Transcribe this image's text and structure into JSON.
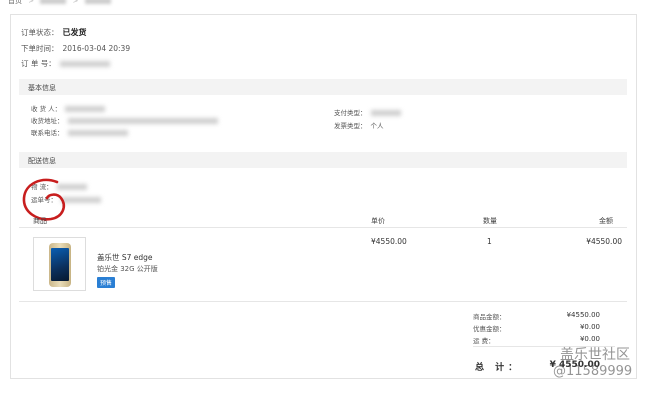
{
  "breadcrumb": {
    "home": "首页",
    "separator": ">"
  },
  "order": {
    "status_label": "订单状态：",
    "status_value": "已发货",
    "time_label": "下单时间：",
    "time_value": "2016-03-04 20:39",
    "number_label": "订 单 号："
  },
  "basic_info": {
    "title": "基本信息",
    "receiver_label": "收 货 人：",
    "address_label": "收货地址：",
    "phone_label": "联系电话：",
    "payment_label": "支付类型：",
    "invoice_label": "发票类型：",
    "invoice_value": "个人"
  },
  "delivery_info": {
    "title": "配送信息",
    "logistics_label": "物    流：",
    "tracking_label": "运单号："
  },
  "table": {
    "headers": {
      "product": "商品",
      "price": "单价",
      "qty": "数量",
      "amount": "金额"
    },
    "rows": [
      {
        "name": "盖乐世 S7 edge",
        "spec": "铂光金  32G  公开版",
        "tag": "预售",
        "price": "¥4550.00",
        "qty": "1",
        "amount": "¥4550.00",
        "image_icon": "phone-icon"
      }
    ]
  },
  "summary": {
    "goods_label": "商品金额：",
    "goods_value": "¥4550.00",
    "discount_label": "优惠金额：",
    "discount_value": "¥0.00",
    "shipping_label": "运    费：",
    "shipping_value": "¥0.00",
    "total_label": "总 计：",
    "total_value": "¥ 4550.00"
  },
  "watermark": {
    "line1": "盖乐世社区",
    "line2": "@11589999"
  },
  "colors": {
    "tag_bg": "#2a7fd4",
    "annotation": "#c81e1e"
  }
}
